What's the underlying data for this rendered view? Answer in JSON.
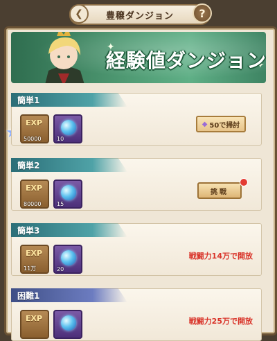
{
  "header": {
    "title": "豊穣ダンジョン",
    "help_icon": "?"
  },
  "banner": {
    "title": "経験値ダンジョン"
  },
  "stages": [
    {
      "name": "簡単1",
      "exp_qty": "50000",
      "orb_qty": "10",
      "action": {
        "type": "sweep",
        "label": "50で掃討"
      }
    },
    {
      "name": "簡単2",
      "exp_qty": "80000",
      "orb_qty": "15",
      "action": {
        "type": "challenge",
        "label": "挑戦"
      }
    },
    {
      "name": "簡単3",
      "exp_qty": "11万",
      "orb_qty": "20",
      "action": {
        "type": "locked",
        "label": "戦闘力14万で開放"
      }
    },
    {
      "name": "困難1",
      "action": {
        "type": "locked",
        "label": "戦闘力25万で開放"
      }
    }
  ],
  "colors": {
    "accent_red": "#d9342a",
    "tab_teal": "#2b6e77",
    "tab_blue": "#3f4f86"
  },
  "exp_label": "EXP"
}
